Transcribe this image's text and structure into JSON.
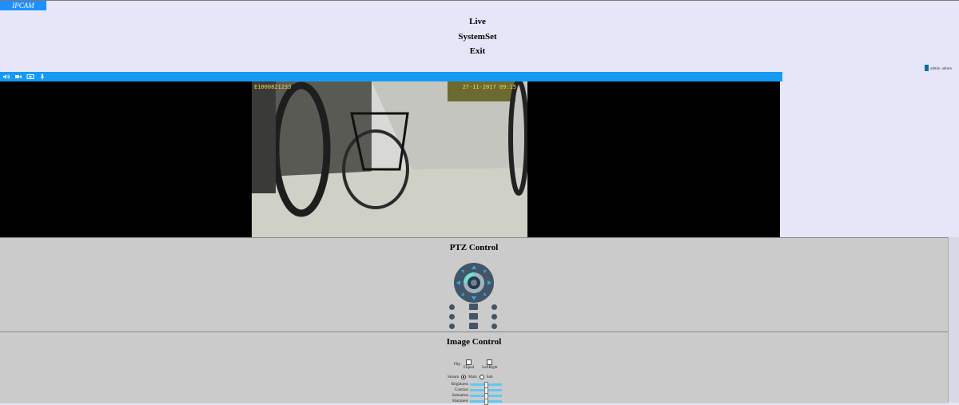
{
  "app": {
    "logo": "IPCAM"
  },
  "nav": {
    "live": "Live",
    "system_set": "SystemSet",
    "exit": "Exit"
  },
  "user": {
    "name": "admin",
    "role": "admin"
  },
  "toolbar": {
    "icons": [
      "speaker-icon",
      "record-icon",
      "snapshot-icon",
      "microphone-icon"
    ]
  },
  "video": {
    "osd_left": "E1000821233",
    "osd_right": "27-11-2017 09:15"
  },
  "ptz": {
    "title": "PTZ Control"
  },
  "image": {
    "title": "Image Control",
    "flip_label": "Flip",
    "flip_options": [
      "Flipud",
      "LeftRight"
    ],
    "stream_label": "Stream",
    "stream_options": [
      "Main",
      "Sub"
    ],
    "stream_selected": "Main",
    "sliders": [
      {
        "label": "Brightness",
        "value": 0.5
      },
      {
        "label": "Contrast",
        "value": 0.5
      },
      {
        "label": "Saturation",
        "value": 0.5
      },
      {
        "label": "Sharpness",
        "value": 0.5
      }
    ]
  },
  "colors": {
    "accent": "#159bf2",
    "panel": "#cbcbcb",
    "background": "#e6e6f8"
  }
}
